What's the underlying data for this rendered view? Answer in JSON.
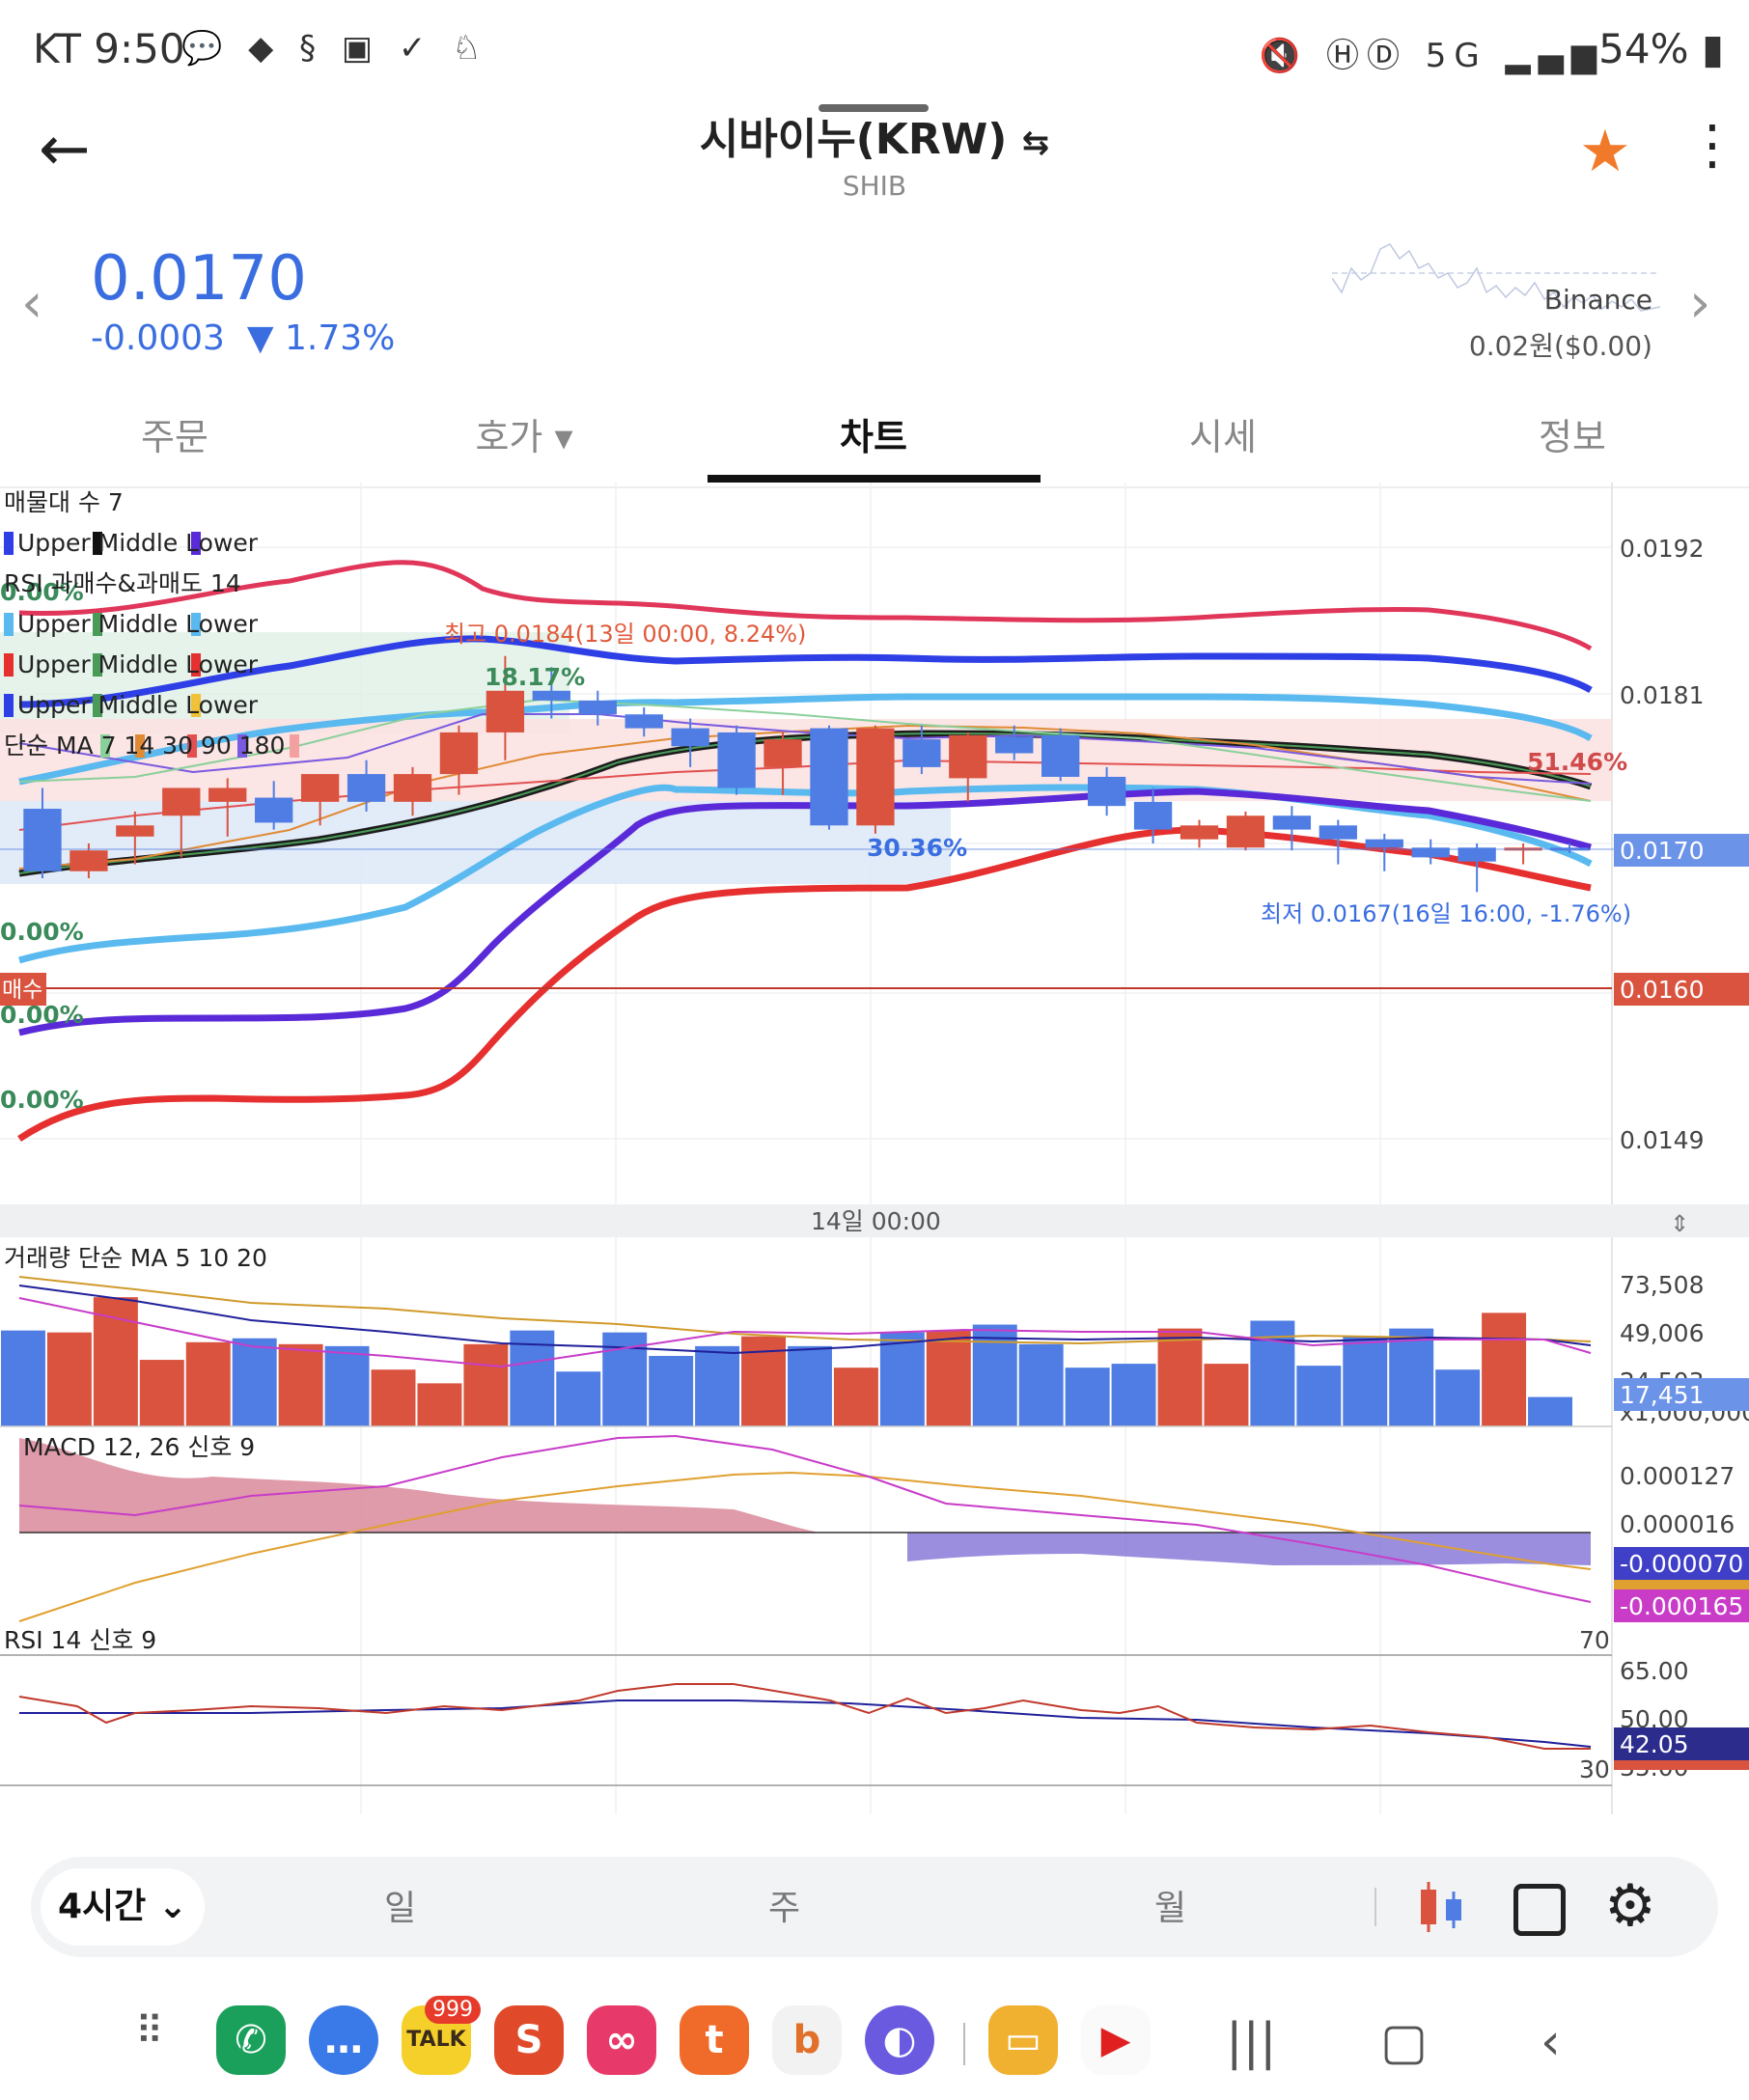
{
  "status_bar": {
    "time": "KT 9:50",
    "notification_icons": [
      "talk-icon",
      "duck-icon",
      "s-icon",
      "image-icon",
      "v-icon",
      "rabbit-icon"
    ],
    "right_icons": [
      "mute-icon",
      "hd-icon",
      "5g-icon",
      "signal-icon"
    ],
    "battery": "54%"
  },
  "header": {
    "title": "시바이누(KRW)",
    "swap_symbol": "⇆",
    "subtitle": "SHIB"
  },
  "price": {
    "value": "0.0170",
    "change": "-0.0003",
    "change_pct": "▼ 1.73%",
    "exchange": "Binance",
    "exchange_price": "0.02원($0.00)"
  },
  "tabs": [
    "주문",
    "호가 ▾",
    "차트",
    "시세",
    "정보"
  ],
  "active_tab": 2,
  "main_chart": {
    "legend_lines": [
      "매물대 수 7",
      "Upper  Middle  Lower",
      "RSI 과매수&과매도 14",
      "Upper  Middle  Lower",
      "Upper  Middle  Lower",
      "Upper  Middle  Lower",
      "단순 MA  7  14  30  90  180"
    ],
    "y_labels": [
      "0.0192",
      "0.0181",
      "0.0170",
      "0.0160",
      "0.0149"
    ],
    "current_price_tag": "0.0170",
    "buy_price_tag": "0.0160",
    "buy_tag": "매수",
    "high_annotation": "최고 0.0184(13일 00:00, 8.24%)",
    "low_annotation": "최저 0.0167(16일 16:00, -1.76%)",
    "pct_labels": [
      "0.00%",
      "18.17%",
      "51.46%",
      "30.36%",
      "0.00%",
      "0.00%",
      "0.00%"
    ],
    "x_label": "14일 00:00"
  },
  "volume": {
    "legend": "거래량 단순 MA  5  10  20",
    "y_labels": [
      "73,508",
      "49,006",
      "24,503",
      "x1,000,000"
    ],
    "current_tag": "17,451"
  },
  "macd": {
    "legend": "MACD 12, 26  신호 9",
    "y_labels": [
      "0.000127",
      "0.000016"
    ],
    "tag_blue": "-0.000070",
    "tag_magenta": "-0.000165"
  },
  "rsi": {
    "legend": "RSI  14 신호  9",
    "level_high": "70",
    "level_low": "30",
    "y_labels": [
      "65.00",
      "50.00",
      "35.00"
    ],
    "current_tag": "42.05"
  },
  "toolbar": {
    "timeframe": "4시간 ⌄",
    "periods": [
      "일",
      "주",
      "월"
    ]
  },
  "colors": {
    "accent_blue": "#3a6ee0",
    "up_red": "#d9533f",
    "down_blue": "#4f7de3",
    "star": "#f07a2a"
  },
  "chart_data": {
    "type": "candlestick",
    "interval": "4h",
    "ylim": [
      0.01445,
      0.01965
    ],
    "candles": [
      {
        "o": 0.0173,
        "h": 0.01745,
        "l": 0.0168,
        "c": 0.01685
      },
      {
        "o": 0.01685,
        "h": 0.01705,
        "l": 0.0168,
        "c": 0.017
      },
      {
        "o": 0.0171,
        "h": 0.01728,
        "l": 0.0169,
        "c": 0.01718
      },
      {
        "o": 0.01725,
        "h": 0.01745,
        "l": 0.01695,
        "c": 0.01745
      },
      {
        "o": 0.01735,
        "h": 0.01752,
        "l": 0.0171,
        "c": 0.01745
      },
      {
        "o": 0.01738,
        "h": 0.0175,
        "l": 0.01715,
        "c": 0.0172
      },
      {
        "o": 0.01735,
        "h": 0.01755,
        "l": 0.01718,
        "c": 0.01755
      },
      {
        "o": 0.01755,
        "h": 0.01765,
        "l": 0.01728,
        "c": 0.01735
      },
      {
        "o": 0.01735,
        "h": 0.0176,
        "l": 0.01725,
        "c": 0.01755
      },
      {
        "o": 0.01755,
        "h": 0.0179,
        "l": 0.0174,
        "c": 0.01785
      },
      {
        "o": 0.01785,
        "h": 0.0184,
        "l": 0.01765,
        "c": 0.01815
      },
      {
        "o": 0.01815,
        "h": 0.01832,
        "l": 0.01795,
        "c": 0.01808
      },
      {
        "o": 0.01808,
        "h": 0.01815,
        "l": 0.0179,
        "c": 0.01798
      },
      {
        "o": 0.01798,
        "h": 0.01803,
        "l": 0.01782,
        "c": 0.01788
      },
      {
        "o": 0.01788,
        "h": 0.01795,
        "l": 0.0176,
        "c": 0.01775
      },
      {
        "o": 0.01785,
        "h": 0.0179,
        "l": 0.0174,
        "c": 0.01745
      },
      {
        "o": 0.0176,
        "h": 0.01785,
        "l": 0.0174,
        "c": 0.0178
      },
      {
        "o": 0.01788,
        "h": 0.0179,
        "l": 0.01715,
        "c": 0.01718
      },
      {
        "o": 0.01718,
        "h": 0.0179,
        "l": 0.01712,
        "c": 0.01788
      },
      {
        "o": 0.0178,
        "h": 0.0179,
        "l": 0.01755,
        "c": 0.0176
      },
      {
        "o": 0.01752,
        "h": 0.01785,
        "l": 0.01735,
        "c": 0.01783
      },
      {
        "o": 0.01782,
        "h": 0.0179,
        "l": 0.01765,
        "c": 0.0177
      },
      {
        "o": 0.01783,
        "h": 0.01788,
        "l": 0.0175,
        "c": 0.01753
      },
      {
        "o": 0.01753,
        "h": 0.0176,
        "l": 0.01725,
        "c": 0.01732
      },
      {
        "o": 0.01735,
        "h": 0.01745,
        "l": 0.01705,
        "c": 0.01715
      },
      {
        "o": 0.01708,
        "h": 0.01722,
        "l": 0.01702,
        "c": 0.01718
      },
      {
        "o": 0.01702,
        "h": 0.01728,
        "l": 0.017,
        "c": 0.01725
      },
      {
        "o": 0.01725,
        "h": 0.01732,
        "l": 0.017,
        "c": 0.01715
      },
      {
        "o": 0.01718,
        "h": 0.01722,
        "l": 0.0169,
        "c": 0.01708
      },
      {
        "o": 0.01708,
        "h": 0.01712,
        "l": 0.01685,
        "c": 0.01702
      },
      {
        "o": 0.01702,
        "h": 0.01708,
        "l": 0.0169,
        "c": 0.01695
      },
      {
        "o": 0.01702,
        "h": 0.01705,
        "l": 0.0167,
        "c": 0.01692
      },
      {
        "o": 0.01702,
        "h": 0.01705,
        "l": 0.0169,
        "c": 0.01702
      },
      {
        "o": 0.01702,
        "h": 0.01705,
        "l": 0.01698,
        "c": 0.017
      }
    ],
    "volume": [
      49,
      48,
      66,
      34,
      43,
      45,
      42,
      41,
      29,
      22,
      42,
      49,
      28,
      48,
      36,
      41,
      46,
      41,
      30,
      48,
      49,
      52,
      42,
      30,
      32,
      50,
      32,
      54,
      31,
      46,
      50,
      29,
      58,
      15
    ],
    "volume_ylim": [
      0,
      100
    ]
  }
}
